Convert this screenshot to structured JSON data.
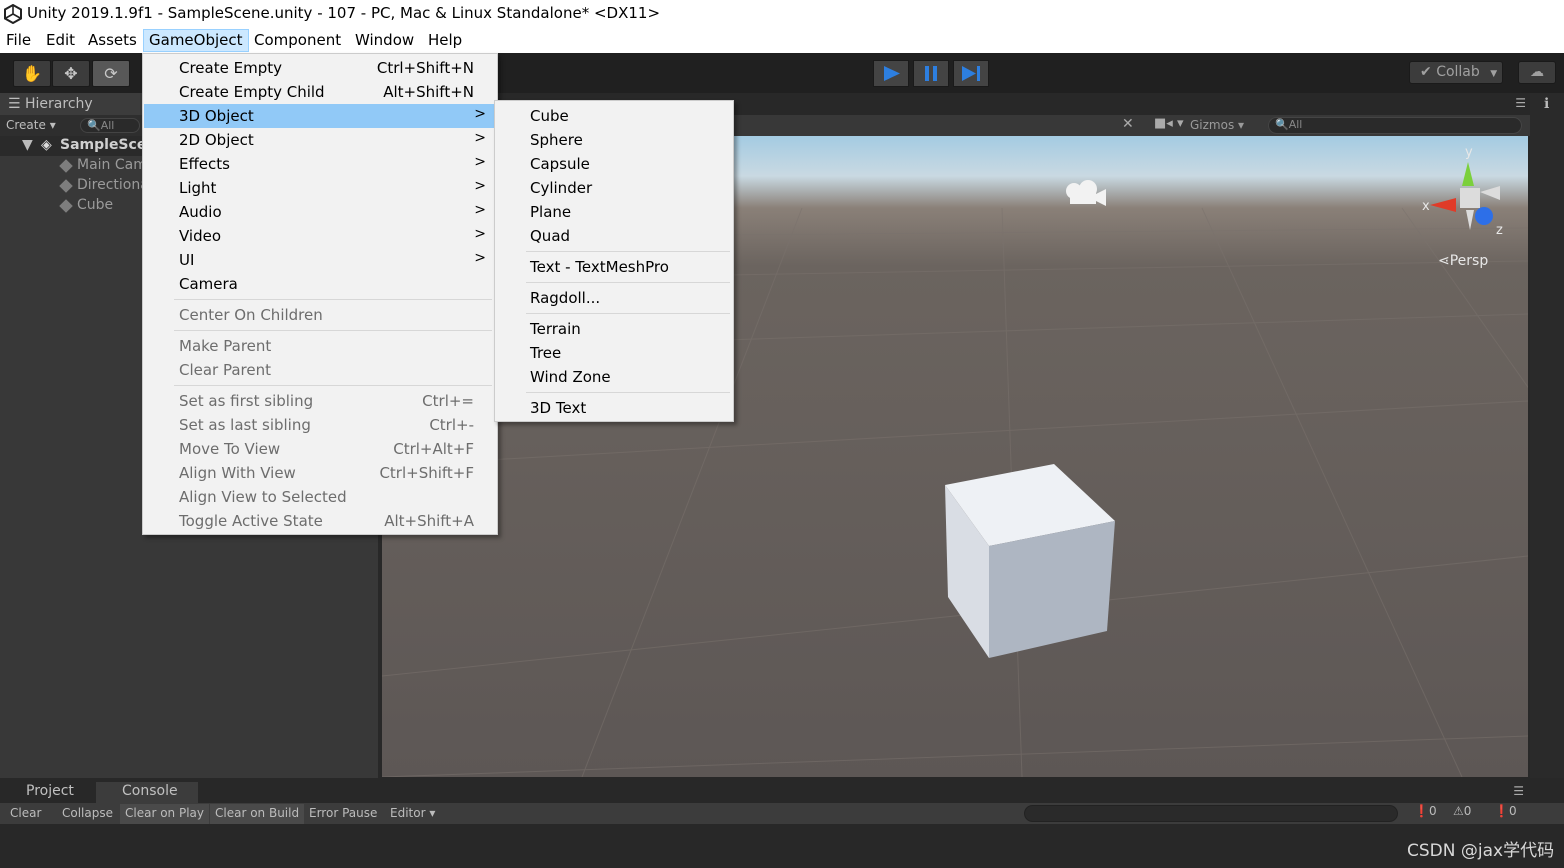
{
  "window": {
    "title": "Unity 2019.1.9f1 - SampleScene.unity - 107 - PC, Mac & Linux Standalone* <DX11>"
  },
  "menubar": [
    "File",
    "Edit",
    "Assets",
    "GameObject",
    "Component",
    "Window",
    "Help"
  ],
  "gameobject_menu": [
    {
      "label": "Create Empty",
      "shortcut": "Ctrl+Shift+N"
    },
    {
      "label": "Create Empty Child",
      "shortcut": "Alt+Shift+N"
    },
    {
      "label": "3D Object",
      "arrow": ">"
    },
    {
      "label": "2D Object",
      "arrow": ">"
    },
    {
      "label": "Effects",
      "arrow": ">"
    },
    {
      "label": "Light",
      "arrow": ">"
    },
    {
      "label": "Audio",
      "arrow": ">"
    },
    {
      "label": "Video",
      "arrow": ">"
    },
    {
      "label": "UI",
      "arrow": ">"
    },
    {
      "label": "Camera"
    },
    {
      "label": "Center On Children"
    },
    {
      "label": "Make Parent"
    },
    {
      "label": "Clear Parent"
    },
    {
      "label": "Set as first sibling",
      "shortcut": "Ctrl+="
    },
    {
      "label": "Set as last sibling",
      "shortcut": "Ctrl+-"
    },
    {
      "label": "Move To View",
      "shortcut": "Ctrl+Alt+F"
    },
    {
      "label": "Align With View",
      "shortcut": "Ctrl+Shift+F"
    },
    {
      "label": "Align View to Selected"
    },
    {
      "label": "Toggle Active State",
      "shortcut": "Alt+Shift+A"
    }
  ],
  "submenu_3d": [
    "Cube",
    "Sphere",
    "Capsule",
    "Cylinder",
    "Plane",
    "Quad",
    "Text - TextMeshPro",
    "Ragdoll...",
    "Terrain",
    "Tree",
    "Wind Zone",
    "3D Text"
  ],
  "toolbar": {
    "tools": [
      "hand-icon",
      "move-icon",
      "rotate-icon"
    ],
    "collab": "Collab",
    "play_controls": [
      "play-icon",
      "pause-icon",
      "step-icon"
    ]
  },
  "hierarchy": {
    "tab": "Hierarchy",
    "create": "Create",
    "search_placeholder": "All",
    "scene": "SampleScene",
    "items": [
      "Main Camera",
      "Directional Light",
      "Cube"
    ]
  },
  "scene": {
    "gizmos": "Gizmos",
    "search_placeholder": "All",
    "persp": "Persp",
    "axes": [
      "x",
      "y",
      "z"
    ]
  },
  "bottom": {
    "tabs": [
      "Project",
      "Console"
    ],
    "console_buttons": [
      "Clear",
      "Collapse",
      "Clear on Play",
      "Clear on Build",
      "Error Pause",
      "Editor"
    ],
    "counts": [
      "0",
      "0",
      "0"
    ]
  },
  "watermark": "CSDN @jax学代码",
  "colors": {
    "menu_highlight": "#91c9f7",
    "menubar_active": "#cce8ff",
    "play_blue": "#2d7fe0"
  }
}
